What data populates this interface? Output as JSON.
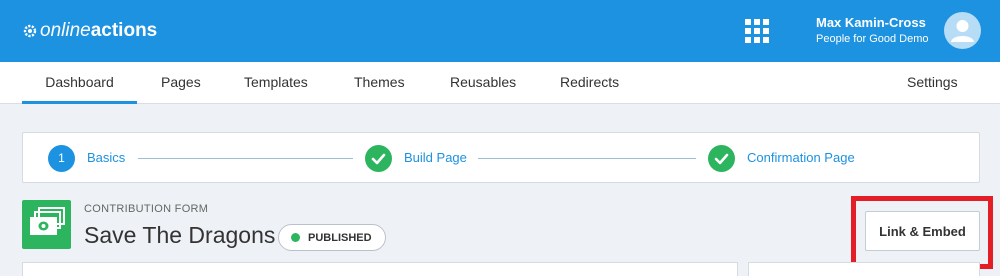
{
  "app": {
    "logo_part1": "online",
    "logo_part2": "actions"
  },
  "user": {
    "name": "Max Kamin-Cross",
    "org": "People for Good Demo"
  },
  "nav": {
    "items": [
      {
        "label": "Dashboard",
        "active": true
      },
      {
        "label": "Pages"
      },
      {
        "label": "Templates"
      },
      {
        "label": "Themes"
      },
      {
        "label": "Reusables"
      },
      {
        "label": "Redirects"
      }
    ],
    "settings_label": "Settings"
  },
  "steps": [
    {
      "number": "1",
      "label": "Basics",
      "state": "current"
    },
    {
      "label": "Build Page",
      "state": "done"
    },
    {
      "label": "Confirmation Page",
      "state": "done"
    }
  ],
  "form": {
    "type_label": "CONTRIBUTION FORM",
    "title": "Save The Dragons",
    "status": "PUBLISHED"
  },
  "actions": {
    "link_embed_label": "Link & Embed"
  },
  "colors": {
    "brand_blue": "#1d92e0",
    "success_green": "#2cb55e",
    "highlight_red": "#e31e26"
  },
  "icons": [
    "gear-logo-icon",
    "apps-grid-icon",
    "user-avatar-icon",
    "check-icon",
    "money-stack-icon"
  ]
}
